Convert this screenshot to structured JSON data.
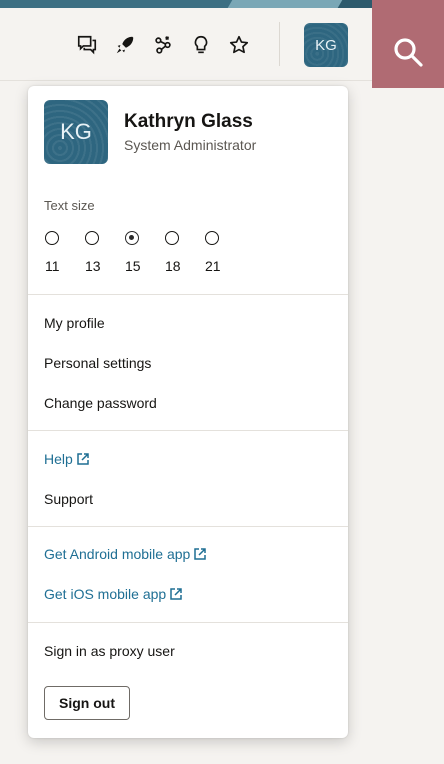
{
  "colors": {
    "header_background": "#f5f3f0",
    "avatar_background": "#2e6680",
    "search_background": "#b06b73",
    "link": "#1f6f94"
  },
  "header": {
    "icons": [
      "messages-icon",
      "rocket-icon",
      "quick-actions-icon",
      "lightbulb-icon",
      "favorites-star-icon"
    ],
    "avatar_initials": "KG",
    "search_icon": "search-icon"
  },
  "menu": {
    "avatar_initials": "KG",
    "user_name": "Kathryn Glass",
    "user_role": "System Administrator",
    "text_size": {
      "label": "Text size",
      "options": [
        "11",
        "13",
        "15",
        "18",
        "21"
      ],
      "selected": "15"
    },
    "profile_items": [
      "My profile",
      "Personal settings",
      "Change password"
    ],
    "help_items": {
      "help": "Help",
      "support": "Support"
    },
    "mobile_links": {
      "android": "Get Android mobile app",
      "ios": "Get iOS mobile app"
    },
    "proxy": "Sign in as proxy user",
    "sign_out": "Sign out"
  }
}
